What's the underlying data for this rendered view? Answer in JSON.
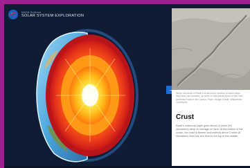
{
  "header": {
    "org": "NASA Science",
    "site_title": "SOLAR SYSTEM EXPLORATION"
  },
  "panel": {
    "caption": "When sections of Earth's crust move relative to each other, fault lines are created, as seen in this aerial photo of the San Andreas Fault in the Carrizo Plain, Image Credit: Wikimedia Commons",
    "heading": "Crust",
    "body": "Earth's outermost layer goes about 19 miles (30 kilometers) deep on average on land. At the bottom of the ocean, the crust is thinner and extends about 3 miles (5 kilometers) from the sea floor to the top of the mantle."
  },
  "next_button": {
    "label": "→"
  },
  "colors": {
    "background": "#0e1c34",
    "border": "#a0208f",
    "accent": "#1e6bd6",
    "core": "#ffd81a",
    "mantle": "#e22b10",
    "crust_ocean": "#3aa0d8"
  },
  "icons": {
    "logo": "nasa-meatball-icon",
    "next": "arrow-right-icon"
  }
}
